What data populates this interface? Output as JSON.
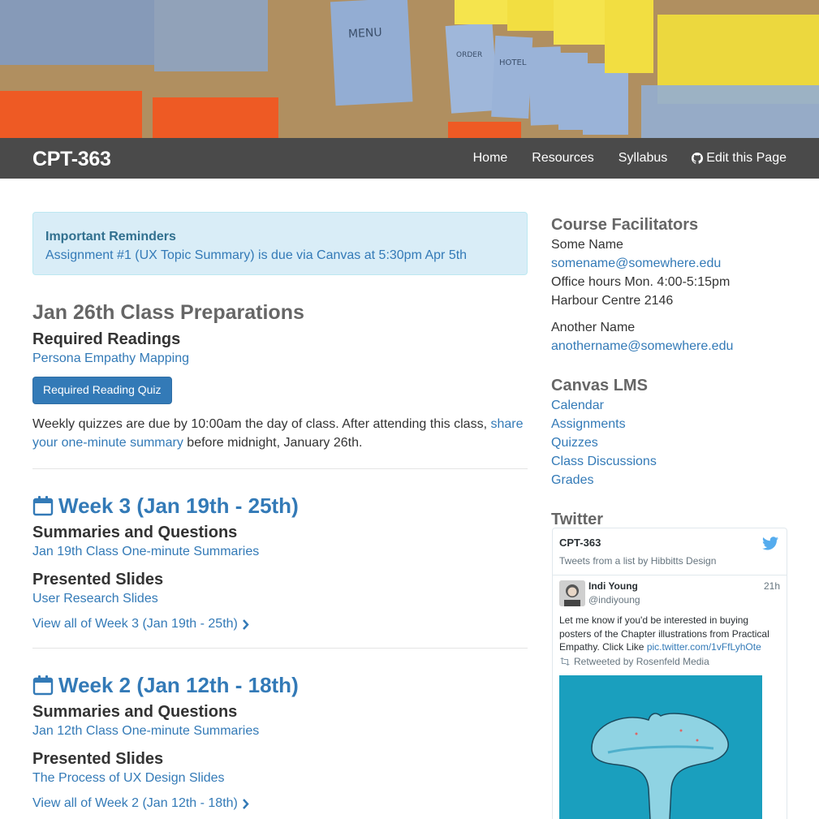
{
  "nav": {
    "brand": "CPT-363",
    "links": [
      "Home",
      "Resources",
      "Syllabus",
      "Edit this Page"
    ]
  },
  "reminder": {
    "title": "Important Reminders",
    "text": "Assignment #1 (UX Topic Summary) is due via Canvas at 5:30pm Apr 5th"
  },
  "prep": {
    "title": "Jan 26th Class Preparations",
    "readings_heading": "Required Readings",
    "reading_link": "Persona Empathy Mapping",
    "quiz_button": "Required Reading Quiz",
    "para_start": "Weekly quizzes are due by 10:00am the day of class. After attending this class,",
    "para_link": "share your one-minute summary",
    "para_end": "before midnight, January 26th."
  },
  "weeks": [
    {
      "title": "Week 3 (Jan 19th - 25th)",
      "summaries_heading": "Summaries and Questions",
      "summaries_link": "Jan 19th Class One-minute Summaries",
      "slides_heading": "Presented Slides",
      "slides_link": "User Research Slides",
      "view_all": "View all of Week 3 (Jan 19th - 25th)"
    },
    {
      "title": "Week 2 (Jan 12th - 18th)",
      "summaries_heading": "Summaries and Questions",
      "summaries_link": "Jan 12th Class One-minute Summaries",
      "slides_heading": "Presented Slides",
      "slides_link": "The Process of UX Design Slides",
      "view_all": "View all of Week 2 (Jan 12th - 18th)"
    }
  ],
  "facilitators": {
    "heading": "Course Facilitators",
    "people": [
      {
        "name": "Some Name",
        "email": "somename@somewhere.edu",
        "hours": "Office hours Mon. 4:00-5:15pm",
        "location": "Harbour Centre 2146"
      },
      {
        "name": "Another Name",
        "email": "anothername@somewhere.edu"
      }
    ]
  },
  "canvas": {
    "heading": "Canvas LMS",
    "links": [
      "Calendar",
      "Assignments",
      "Quizzes",
      "Class Discussions",
      "Grades"
    ]
  },
  "twitter": {
    "heading": "Twitter",
    "widget_title": "CPT-363",
    "widget_sub": "Tweets from a list by Hibbitts Design",
    "tweet": {
      "name": "Indi Young",
      "handle": "@indiyoung",
      "time": "21h",
      "text": "Let me know if you'd be interested in buying posters of the Chapter illustrations from Practical Empathy. Click Like",
      "link": "pic.twitter.com/1vFfLyhOte",
      "retweet": "Retweeted by Rosenfeld Media"
    }
  },
  "colors": {
    "navbar": "#4a4a4a",
    "link": "#337ab7",
    "alert_bg": "#d9edf7",
    "twitter_blue": "#55acee"
  }
}
